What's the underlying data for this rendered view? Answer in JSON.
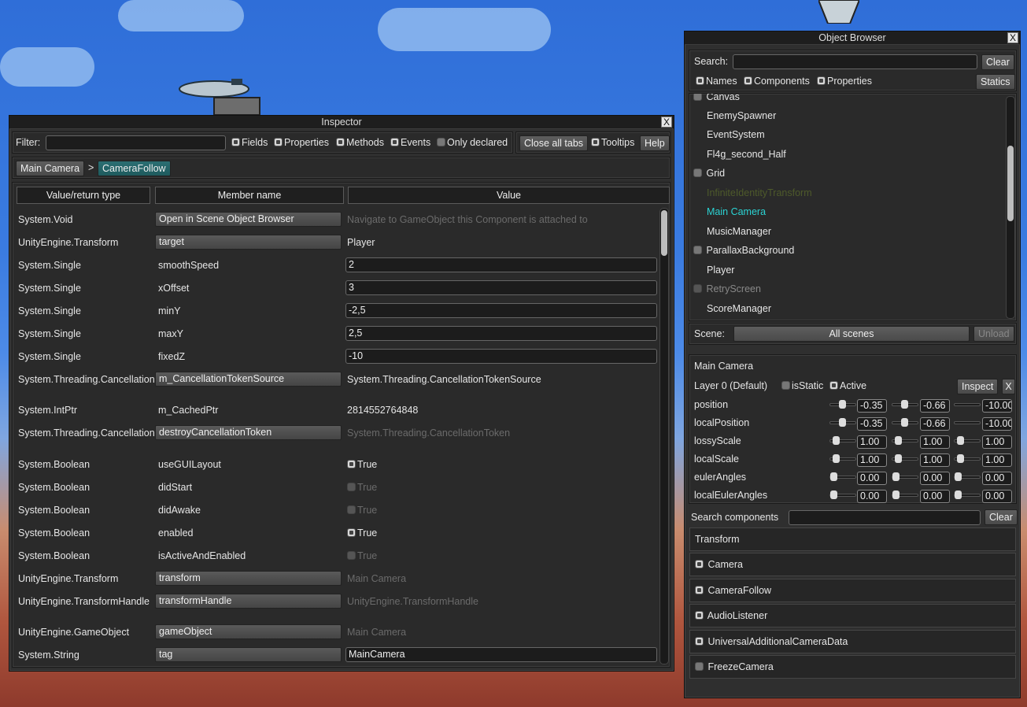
{
  "inspector": {
    "title": "Inspector",
    "close": "X",
    "filter_label": "Filter:",
    "filter_value": "",
    "toggles": [
      "Fields",
      "Properties",
      "Methods",
      "Events",
      "Only declared"
    ],
    "close_all_tabs": "Close all tabs",
    "tooltips": "Tooltips",
    "help": "Help",
    "breadcrumb": {
      "first": "Main Camera",
      "sep": ">",
      "second": "CameraFollow"
    },
    "columns": [
      "Value/return type",
      "Member name",
      "Value"
    ],
    "rows": [
      {
        "type": "System.Void",
        "member": "Open in Scene Object Browser",
        "value": "Navigate to GameObject this Component is attached to"
      },
      {
        "type": "UnityEngine.Transform",
        "member": "target",
        "value": "Player"
      },
      {
        "type": "System.Single",
        "member": "smoothSpeed",
        "value": "2"
      },
      {
        "type": "System.Single",
        "member": "xOffset",
        "value": "3"
      },
      {
        "type": "System.Single",
        "member": "minY",
        "value": "-2,5"
      },
      {
        "type": "System.Single",
        "member": "maxY",
        "value": "2,5"
      },
      {
        "type": "System.Single",
        "member": "fixedZ",
        "value": "-10"
      },
      {
        "type": "System.Threading.CancellationTokenSource",
        "member": "m_CancellationTokenSource",
        "value": "System.Threading.CancellationTokenSource"
      },
      {
        "type": "System.IntPtr",
        "member": "m_CachedPtr",
        "value": "2814552764848"
      },
      {
        "type": "System.Threading.CancellationToken",
        "member": "destroyCancellationToken",
        "value": "System.Threading.CancellationToken"
      },
      {
        "type": "System.Boolean",
        "member": "useGUILayout",
        "value": "True"
      },
      {
        "type": "System.Boolean",
        "member": "didStart",
        "value": "True"
      },
      {
        "type": "System.Boolean",
        "member": "didAwake",
        "value": "True"
      },
      {
        "type": "System.Boolean",
        "member": "enabled",
        "value": "True"
      },
      {
        "type": "System.Boolean",
        "member": "isActiveAndEnabled",
        "value": "True"
      },
      {
        "type": "UnityEngine.Transform",
        "member": "transform",
        "value": "Main Camera"
      },
      {
        "type": "UnityEngine.TransformHandle",
        "member": "transformHandle",
        "value": "UnityEngine.TransformHandle"
      },
      {
        "type": "UnityEngine.GameObject",
        "member": "gameObject",
        "value": "Main Camera"
      },
      {
        "type": "System.String",
        "member": "tag",
        "value": "MainCamera"
      }
    ]
  },
  "browser": {
    "title": "Object Browser",
    "close": "X",
    "search_label": "Search:",
    "search_value": "",
    "clear": "Clear",
    "filters": [
      "Names",
      "Components",
      "Properties"
    ],
    "statics": "Statics",
    "objects": [
      "Canvas",
      "EnemySpawner",
      "EventSystem",
      "Fl4g_second_Half",
      "Grid",
      "InfiniteIdentityTransform",
      "Main Camera",
      "MusicManager",
      "ParallaxBackground",
      "Player",
      "RetryScreen",
      "ScoreManager"
    ],
    "scene_label": "Scene:",
    "scene_value": "All scenes",
    "unload": "Unload",
    "selected": {
      "name": "Main Camera",
      "layer": "Layer 0 (Default)",
      "is_static": "isStatic",
      "active": "Active",
      "inspect": "Inspect",
      "close": "X",
      "transform": [
        {
          "label": "position",
          "x": "-0.35",
          "y": "-0.66",
          "z": "-10.00"
        },
        {
          "label": "localPosition",
          "x": "-0.35",
          "y": "-0.66",
          "z": "-10.00"
        },
        {
          "label": "lossyScale",
          "x": "1.00",
          "y": "1.00",
          "z": "1.00"
        },
        {
          "label": "localScale",
          "x": "1.00",
          "y": "1.00",
          "z": "1.00"
        },
        {
          "label": "eulerAngles",
          "x": "0.00",
          "y": "0.00",
          "z": "0.00"
        },
        {
          "label": "localEulerAngles",
          "x": "0.00",
          "y": "0.00",
          "z": "0.00"
        }
      ]
    },
    "search_components_label": "Search components",
    "search_components_value": "",
    "components_clear": "Clear",
    "components": [
      "Transform",
      "Camera",
      "CameraFollow",
      "AudioListener",
      "UniversalAdditionalCameraData",
      "FreezeCamera"
    ]
  },
  "colors": {
    "accent": "#2bd3d3",
    "teal_button": "#2b6f73"
  }
}
